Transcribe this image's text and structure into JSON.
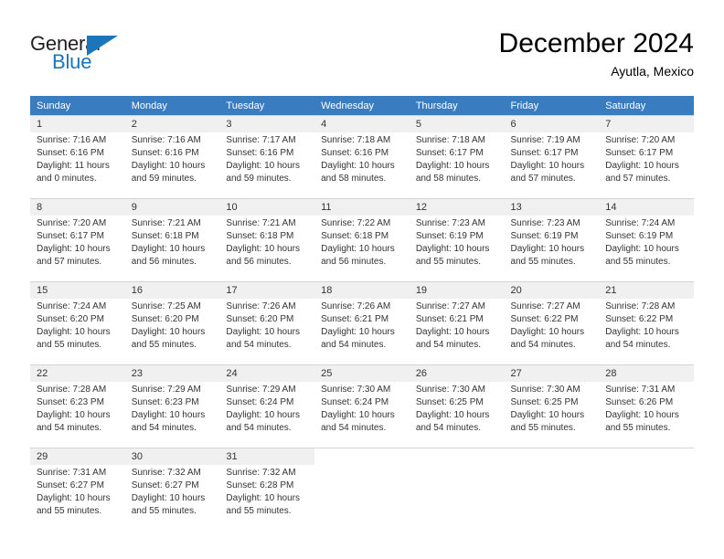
{
  "logo": {
    "word_top": "General",
    "word_bottom": "Blue",
    "accent_color": "#1b75bb",
    "text_color": "#231f20"
  },
  "header": {
    "title": "December 2024",
    "subtitle": "Ayutla, Mexico"
  },
  "calendar": {
    "header_bg": "#3a7cc0",
    "date_band_bg": "#f0f0f0",
    "weekdays": [
      "Sunday",
      "Monday",
      "Tuesday",
      "Wednesday",
      "Thursday",
      "Friday",
      "Saturday"
    ],
    "weeks": [
      [
        {
          "day": "1",
          "sunrise": "Sunrise: 7:16 AM",
          "sunset": "Sunset: 6:16 PM",
          "daylight_line1": "Daylight: 11 hours",
          "daylight_line2": "and 0 minutes."
        },
        {
          "day": "2",
          "sunrise": "Sunrise: 7:16 AM",
          "sunset": "Sunset: 6:16 PM",
          "daylight_line1": "Daylight: 10 hours",
          "daylight_line2": "and 59 minutes."
        },
        {
          "day": "3",
          "sunrise": "Sunrise: 7:17 AM",
          "sunset": "Sunset: 6:16 PM",
          "daylight_line1": "Daylight: 10 hours",
          "daylight_line2": "and 59 minutes."
        },
        {
          "day": "4",
          "sunrise": "Sunrise: 7:18 AM",
          "sunset": "Sunset: 6:16 PM",
          "daylight_line1": "Daylight: 10 hours",
          "daylight_line2": "and 58 minutes."
        },
        {
          "day": "5",
          "sunrise": "Sunrise: 7:18 AM",
          "sunset": "Sunset: 6:17 PM",
          "daylight_line1": "Daylight: 10 hours",
          "daylight_line2": "and 58 minutes."
        },
        {
          "day": "6",
          "sunrise": "Sunrise: 7:19 AM",
          "sunset": "Sunset: 6:17 PM",
          "daylight_line1": "Daylight: 10 hours",
          "daylight_line2": "and 57 minutes."
        },
        {
          "day": "7",
          "sunrise": "Sunrise: 7:20 AM",
          "sunset": "Sunset: 6:17 PM",
          "daylight_line1": "Daylight: 10 hours",
          "daylight_line2": "and 57 minutes."
        }
      ],
      [
        {
          "day": "8",
          "sunrise": "Sunrise: 7:20 AM",
          "sunset": "Sunset: 6:17 PM",
          "daylight_line1": "Daylight: 10 hours",
          "daylight_line2": "and 57 minutes."
        },
        {
          "day": "9",
          "sunrise": "Sunrise: 7:21 AM",
          "sunset": "Sunset: 6:18 PM",
          "daylight_line1": "Daylight: 10 hours",
          "daylight_line2": "and 56 minutes."
        },
        {
          "day": "10",
          "sunrise": "Sunrise: 7:21 AM",
          "sunset": "Sunset: 6:18 PM",
          "daylight_line1": "Daylight: 10 hours",
          "daylight_line2": "and 56 minutes."
        },
        {
          "day": "11",
          "sunrise": "Sunrise: 7:22 AM",
          "sunset": "Sunset: 6:18 PM",
          "daylight_line1": "Daylight: 10 hours",
          "daylight_line2": "and 56 minutes."
        },
        {
          "day": "12",
          "sunrise": "Sunrise: 7:23 AM",
          "sunset": "Sunset: 6:19 PM",
          "daylight_line1": "Daylight: 10 hours",
          "daylight_line2": "and 55 minutes."
        },
        {
          "day": "13",
          "sunrise": "Sunrise: 7:23 AM",
          "sunset": "Sunset: 6:19 PM",
          "daylight_line1": "Daylight: 10 hours",
          "daylight_line2": "and 55 minutes."
        },
        {
          "day": "14",
          "sunrise": "Sunrise: 7:24 AM",
          "sunset": "Sunset: 6:19 PM",
          "daylight_line1": "Daylight: 10 hours",
          "daylight_line2": "and 55 minutes."
        }
      ],
      [
        {
          "day": "15",
          "sunrise": "Sunrise: 7:24 AM",
          "sunset": "Sunset: 6:20 PM",
          "daylight_line1": "Daylight: 10 hours",
          "daylight_line2": "and 55 minutes."
        },
        {
          "day": "16",
          "sunrise": "Sunrise: 7:25 AM",
          "sunset": "Sunset: 6:20 PM",
          "daylight_line1": "Daylight: 10 hours",
          "daylight_line2": "and 55 minutes."
        },
        {
          "day": "17",
          "sunrise": "Sunrise: 7:26 AM",
          "sunset": "Sunset: 6:20 PM",
          "daylight_line1": "Daylight: 10 hours",
          "daylight_line2": "and 54 minutes."
        },
        {
          "day": "18",
          "sunrise": "Sunrise: 7:26 AM",
          "sunset": "Sunset: 6:21 PM",
          "daylight_line1": "Daylight: 10 hours",
          "daylight_line2": "and 54 minutes."
        },
        {
          "day": "19",
          "sunrise": "Sunrise: 7:27 AM",
          "sunset": "Sunset: 6:21 PM",
          "daylight_line1": "Daylight: 10 hours",
          "daylight_line2": "and 54 minutes."
        },
        {
          "day": "20",
          "sunrise": "Sunrise: 7:27 AM",
          "sunset": "Sunset: 6:22 PM",
          "daylight_line1": "Daylight: 10 hours",
          "daylight_line2": "and 54 minutes."
        },
        {
          "day": "21",
          "sunrise": "Sunrise: 7:28 AM",
          "sunset": "Sunset: 6:22 PM",
          "daylight_line1": "Daylight: 10 hours",
          "daylight_line2": "and 54 minutes."
        }
      ],
      [
        {
          "day": "22",
          "sunrise": "Sunrise: 7:28 AM",
          "sunset": "Sunset: 6:23 PM",
          "daylight_line1": "Daylight: 10 hours",
          "daylight_line2": "and 54 minutes."
        },
        {
          "day": "23",
          "sunrise": "Sunrise: 7:29 AM",
          "sunset": "Sunset: 6:23 PM",
          "daylight_line1": "Daylight: 10 hours",
          "daylight_line2": "and 54 minutes."
        },
        {
          "day": "24",
          "sunrise": "Sunrise: 7:29 AM",
          "sunset": "Sunset: 6:24 PM",
          "daylight_line1": "Daylight: 10 hours",
          "daylight_line2": "and 54 minutes."
        },
        {
          "day": "25",
          "sunrise": "Sunrise: 7:30 AM",
          "sunset": "Sunset: 6:24 PM",
          "daylight_line1": "Daylight: 10 hours",
          "daylight_line2": "and 54 minutes."
        },
        {
          "day": "26",
          "sunrise": "Sunrise: 7:30 AM",
          "sunset": "Sunset: 6:25 PM",
          "daylight_line1": "Daylight: 10 hours",
          "daylight_line2": "and 54 minutes."
        },
        {
          "day": "27",
          "sunrise": "Sunrise: 7:30 AM",
          "sunset": "Sunset: 6:25 PM",
          "daylight_line1": "Daylight: 10 hours",
          "daylight_line2": "and 55 minutes."
        },
        {
          "day": "28",
          "sunrise": "Sunrise: 7:31 AM",
          "sunset": "Sunset: 6:26 PM",
          "daylight_line1": "Daylight: 10 hours",
          "daylight_line2": "and 55 minutes."
        }
      ],
      [
        {
          "day": "29",
          "sunrise": "Sunrise: 7:31 AM",
          "sunset": "Sunset: 6:27 PM",
          "daylight_line1": "Daylight: 10 hours",
          "daylight_line2": "and 55 minutes."
        },
        {
          "day": "30",
          "sunrise": "Sunrise: 7:32 AM",
          "sunset": "Sunset: 6:27 PM",
          "daylight_line1": "Daylight: 10 hours",
          "daylight_line2": "and 55 minutes."
        },
        {
          "day": "31",
          "sunrise": "Sunrise: 7:32 AM",
          "sunset": "Sunset: 6:28 PM",
          "daylight_line1": "Daylight: 10 hours",
          "daylight_line2": "and 55 minutes."
        },
        {
          "day": "",
          "sunrise": "",
          "sunset": "",
          "daylight_line1": "",
          "daylight_line2": ""
        },
        {
          "day": "",
          "sunrise": "",
          "sunset": "",
          "daylight_line1": "",
          "daylight_line2": ""
        },
        {
          "day": "",
          "sunrise": "",
          "sunset": "",
          "daylight_line1": "",
          "daylight_line2": ""
        },
        {
          "day": "",
          "sunrise": "",
          "sunset": "",
          "daylight_line1": "",
          "daylight_line2": ""
        }
      ]
    ]
  }
}
